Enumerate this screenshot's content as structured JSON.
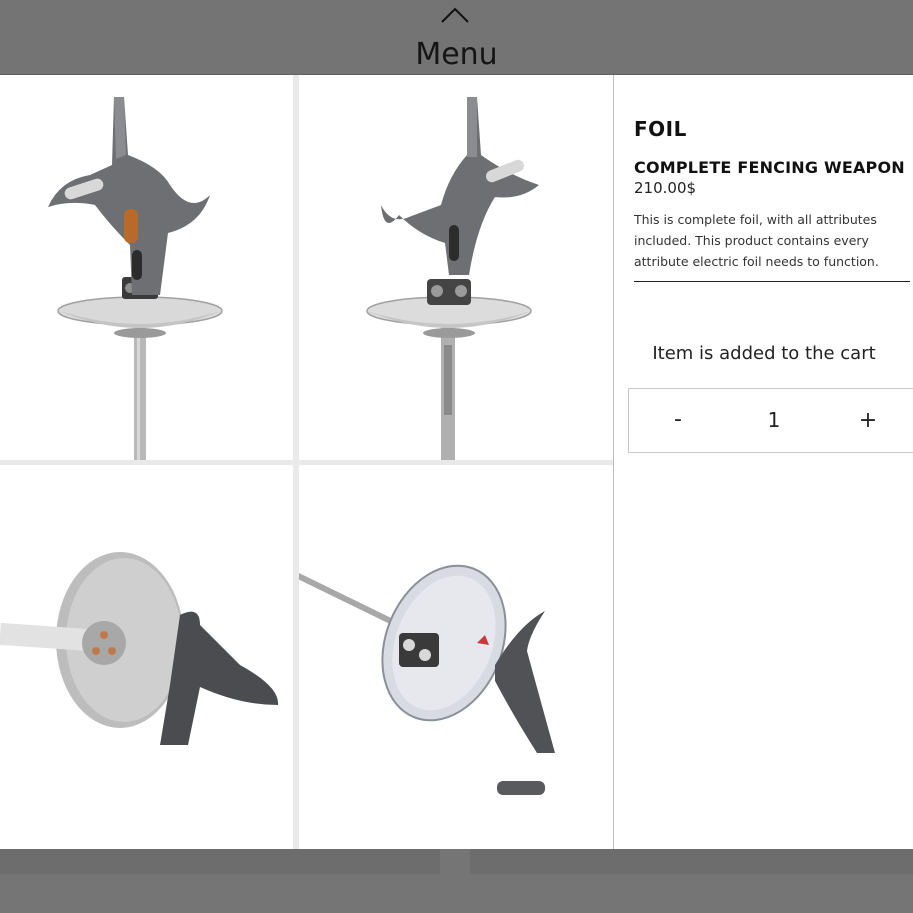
{
  "menu": {
    "label": "Menu",
    "toggle_icon": "chevron-up-icon"
  },
  "gallery": {
    "images": [
      {
        "name": "foil-guard-front-view"
      },
      {
        "name": "foil-guard-back-view"
      },
      {
        "name": "foil-bell-apex-side-view"
      },
      {
        "name": "foil-bell-inside-view"
      }
    ]
  },
  "product": {
    "category": "FOIL",
    "name": "COMPLETE FENCING WEAPON",
    "price": "210.00$",
    "description": "This is complete foil, with all attributes included. This product contains every attribute electric foil needs to function.",
    "cart_notice": "Item is added to the cart",
    "quantity": {
      "minus_label": "-",
      "value": "1",
      "plus_label": "+"
    }
  },
  "colors": {
    "overlay": "#747474",
    "panel_bg": "#ffffff",
    "text": "#111111"
  }
}
